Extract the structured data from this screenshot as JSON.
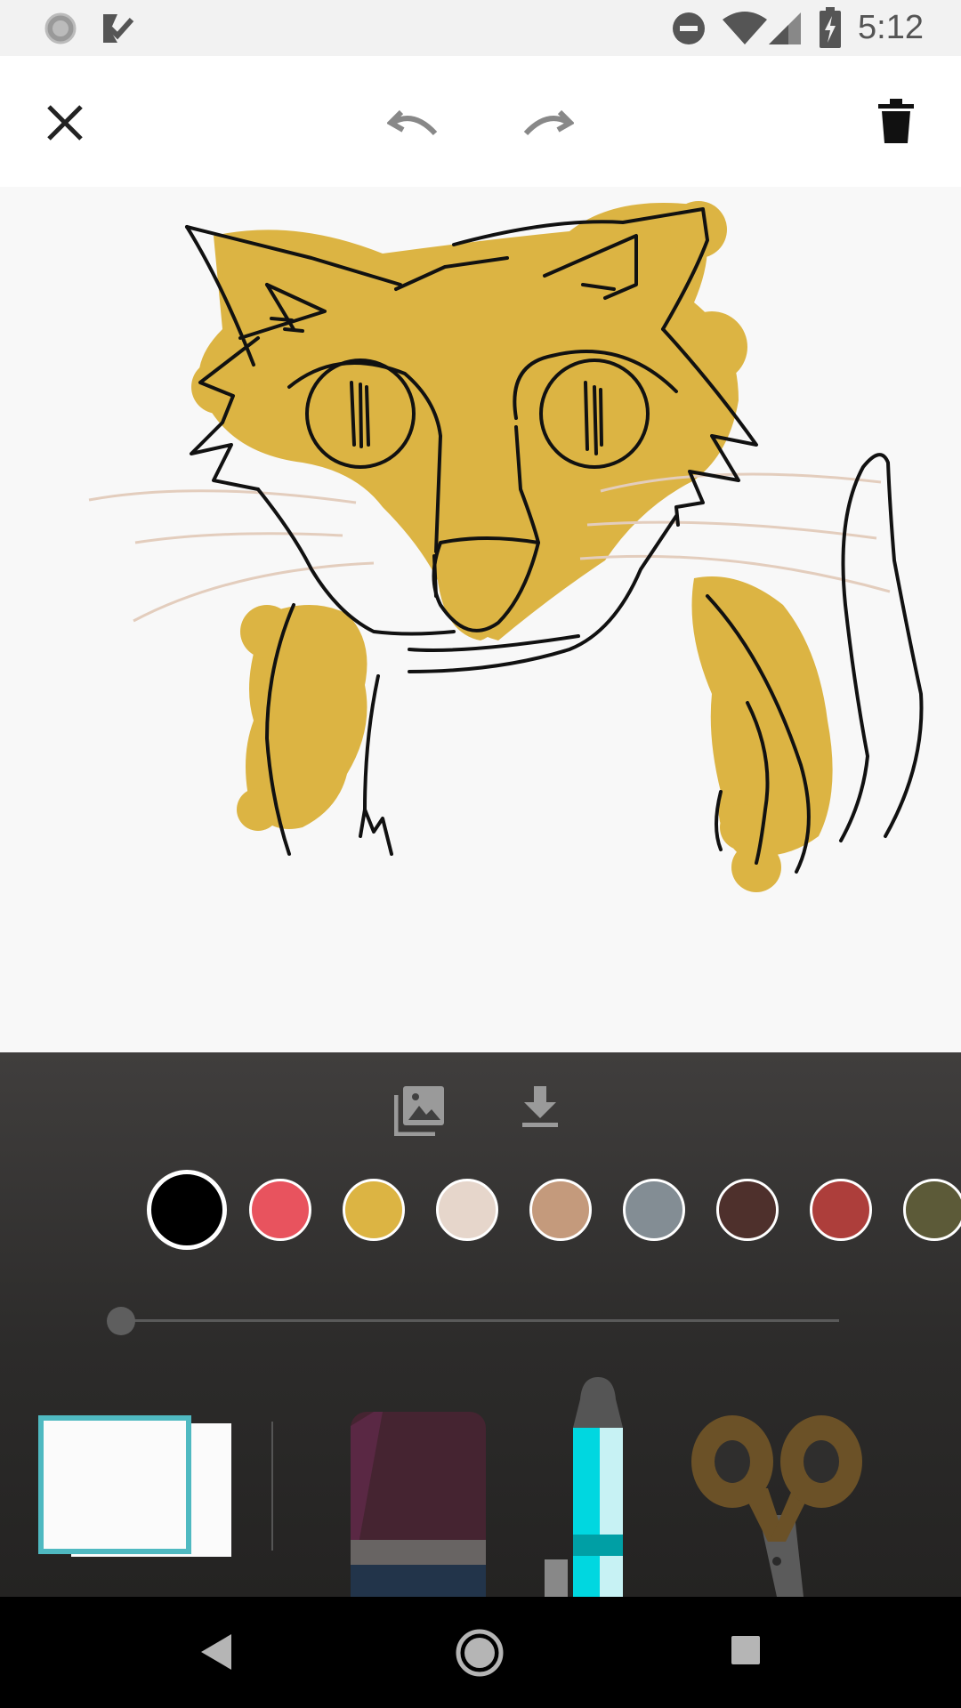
{
  "status_bar": {
    "time": "5:12",
    "icons": [
      "sync-icon",
      "check-task-icon",
      "do-not-disturb-icon",
      "wifi-icon",
      "cell-signal-icon",
      "battery-charging-icon"
    ]
  },
  "toolbar": {
    "icons": [
      "close-icon",
      "undo-icon",
      "redo-icon",
      "trash-icon"
    ]
  },
  "panel": {
    "action_icons": [
      "gallery-icon",
      "download-icon"
    ],
    "colors": [
      "#000000",
      "#e8535e",
      "#dcb443",
      "#e6d6cb",
      "#c49a7c",
      "#838d94",
      "#4e302c",
      "#ad3e3b",
      "#5c5a38"
    ],
    "selected_color": "#000000",
    "brush_size": 0,
    "tools": [
      "paper-tool",
      "marker-tool",
      "pen-tool",
      "scissors-tool"
    ]
  },
  "navbar": {
    "icons": [
      "back-icon",
      "home-icon",
      "recents-icon"
    ]
  }
}
